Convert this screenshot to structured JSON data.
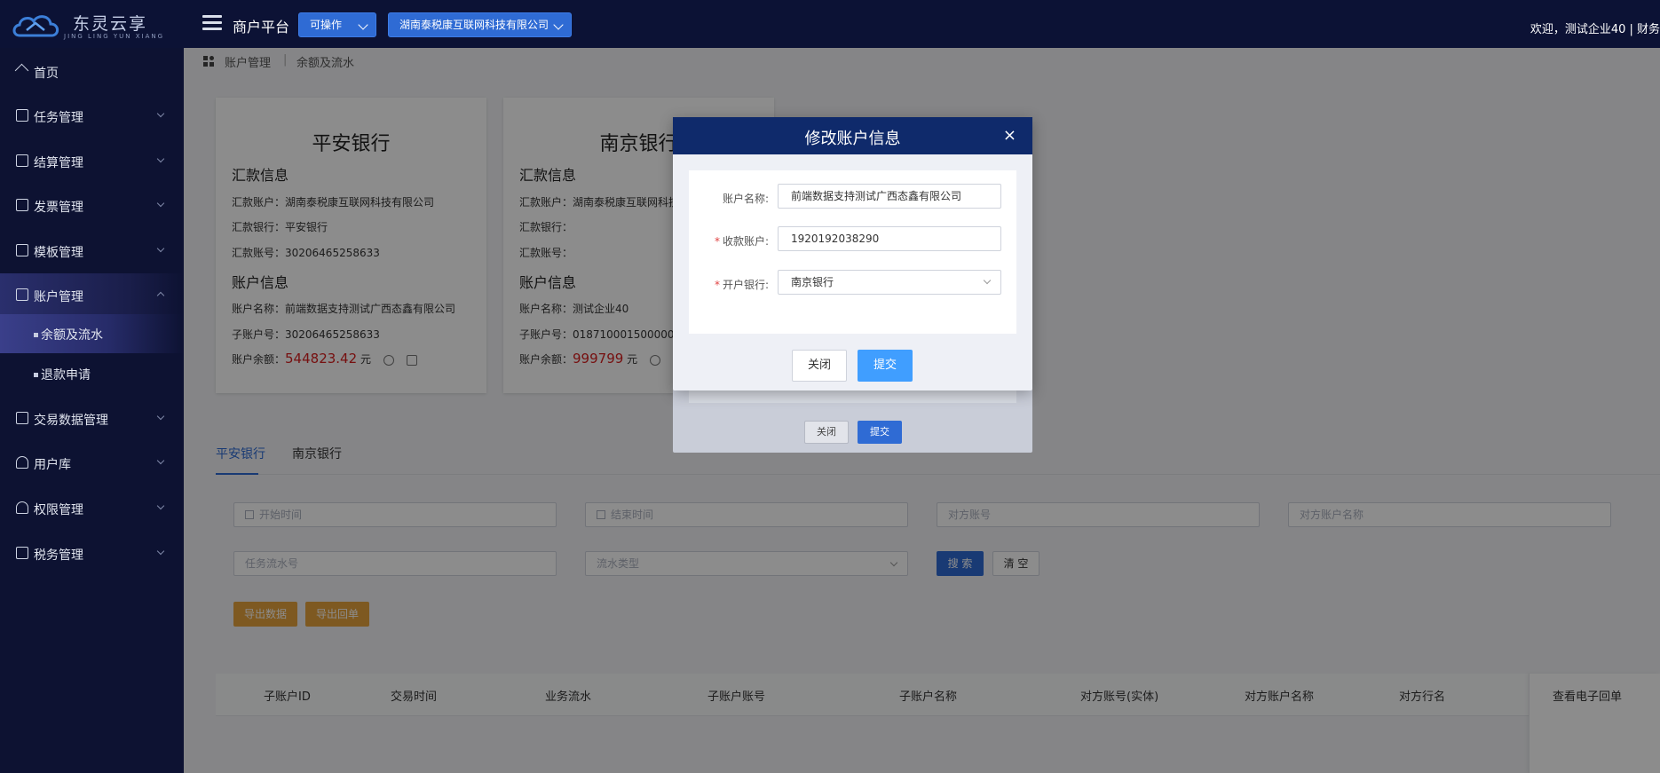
{
  "header": {
    "logo_text": "东灵云享",
    "logo_sub": "JING LING YUN XIANG",
    "platform_title": "商户平台",
    "status_select": "可操作",
    "company_select": "湖南泰税康互联网科技有限公司",
    "welcome": "欢迎，测试企业40 | 财务"
  },
  "sidebar": {
    "items": [
      {
        "label": "首页"
      },
      {
        "label": "任务管理"
      },
      {
        "label": "结算管理"
      },
      {
        "label": "发票管理"
      },
      {
        "label": "模板管理"
      },
      {
        "label": "账户管理"
      },
      {
        "label": "交易数据管理"
      },
      {
        "label": "用户库"
      },
      {
        "label": "权限管理"
      },
      {
        "label": "税务管理"
      }
    ],
    "sub_items": [
      {
        "label": "余额及流水"
      },
      {
        "label": "退款申请"
      }
    ]
  },
  "breadcrumb": {
    "level1": "账户管理",
    "sep": "|",
    "level2": "余额及流水"
  },
  "cards": [
    {
      "bank": "平安银行",
      "remit_title": "汇款信息",
      "remit_account": "汇款账户：湖南泰税康互联网科技有限公司",
      "remit_bank": "汇款银行：平安银行",
      "remit_no": "汇款账号：30206465258633",
      "acct_title": "账户信息",
      "acct_name": "账户名称：前端数据支持测试广西态鑫有限公司",
      "sub_no": "子账户号：30206465258633",
      "balance_label": "账户余额：",
      "balance": "544823.42",
      "unit": "元"
    },
    {
      "bank": "南京银行",
      "remit_title": "汇款信息",
      "remit_account": "汇款账户：湖南泰税康互联网科技",
      "remit_bank": "汇款银行：",
      "remit_no": "汇款账号：",
      "acct_title": "账户信息",
      "acct_name": "账户名称：测试企业40",
      "sub_no": "子账户号：018710001500000000",
      "balance_label": "账户余额：",
      "balance": "999799",
      "unit": "元"
    }
  ],
  "tabs": [
    "平安银行",
    "南京银行"
  ],
  "filters": {
    "start_time": "开始时间",
    "end_time": "结束时间",
    "counter_account": "对方账号",
    "counter_name": "对方账户名称",
    "task_serial": "任务流水号",
    "flow_type": "流水类型",
    "search": "搜 索",
    "clear": "清 空",
    "export_data": "导出数据",
    "export_receipt": "导出回单"
  },
  "table": {
    "columns": [
      "子账户ID",
      "交易时间",
      "业务流水",
      "子账户账号",
      "子账户名称",
      "对方账号(实体)",
      "对方账户名称",
      "对方行名",
      "查看电子回单"
    ]
  },
  "back_dialog": {
    "close": "关闭",
    "submit": "提交"
  },
  "dialog": {
    "title": "修改账户信息",
    "close_symbol": "×",
    "fields": [
      {
        "label": "账户名称:",
        "required": false,
        "value": "前端数据支持测试广西态鑫有限公司"
      },
      {
        "label": "收款账户:",
        "required": true,
        "value": "1920192038290"
      },
      {
        "label": "开户银行:",
        "required": true,
        "value": "南京银行"
      }
    ],
    "required_mark": "*",
    "close_button": "关闭",
    "submit_button": "提交"
  }
}
